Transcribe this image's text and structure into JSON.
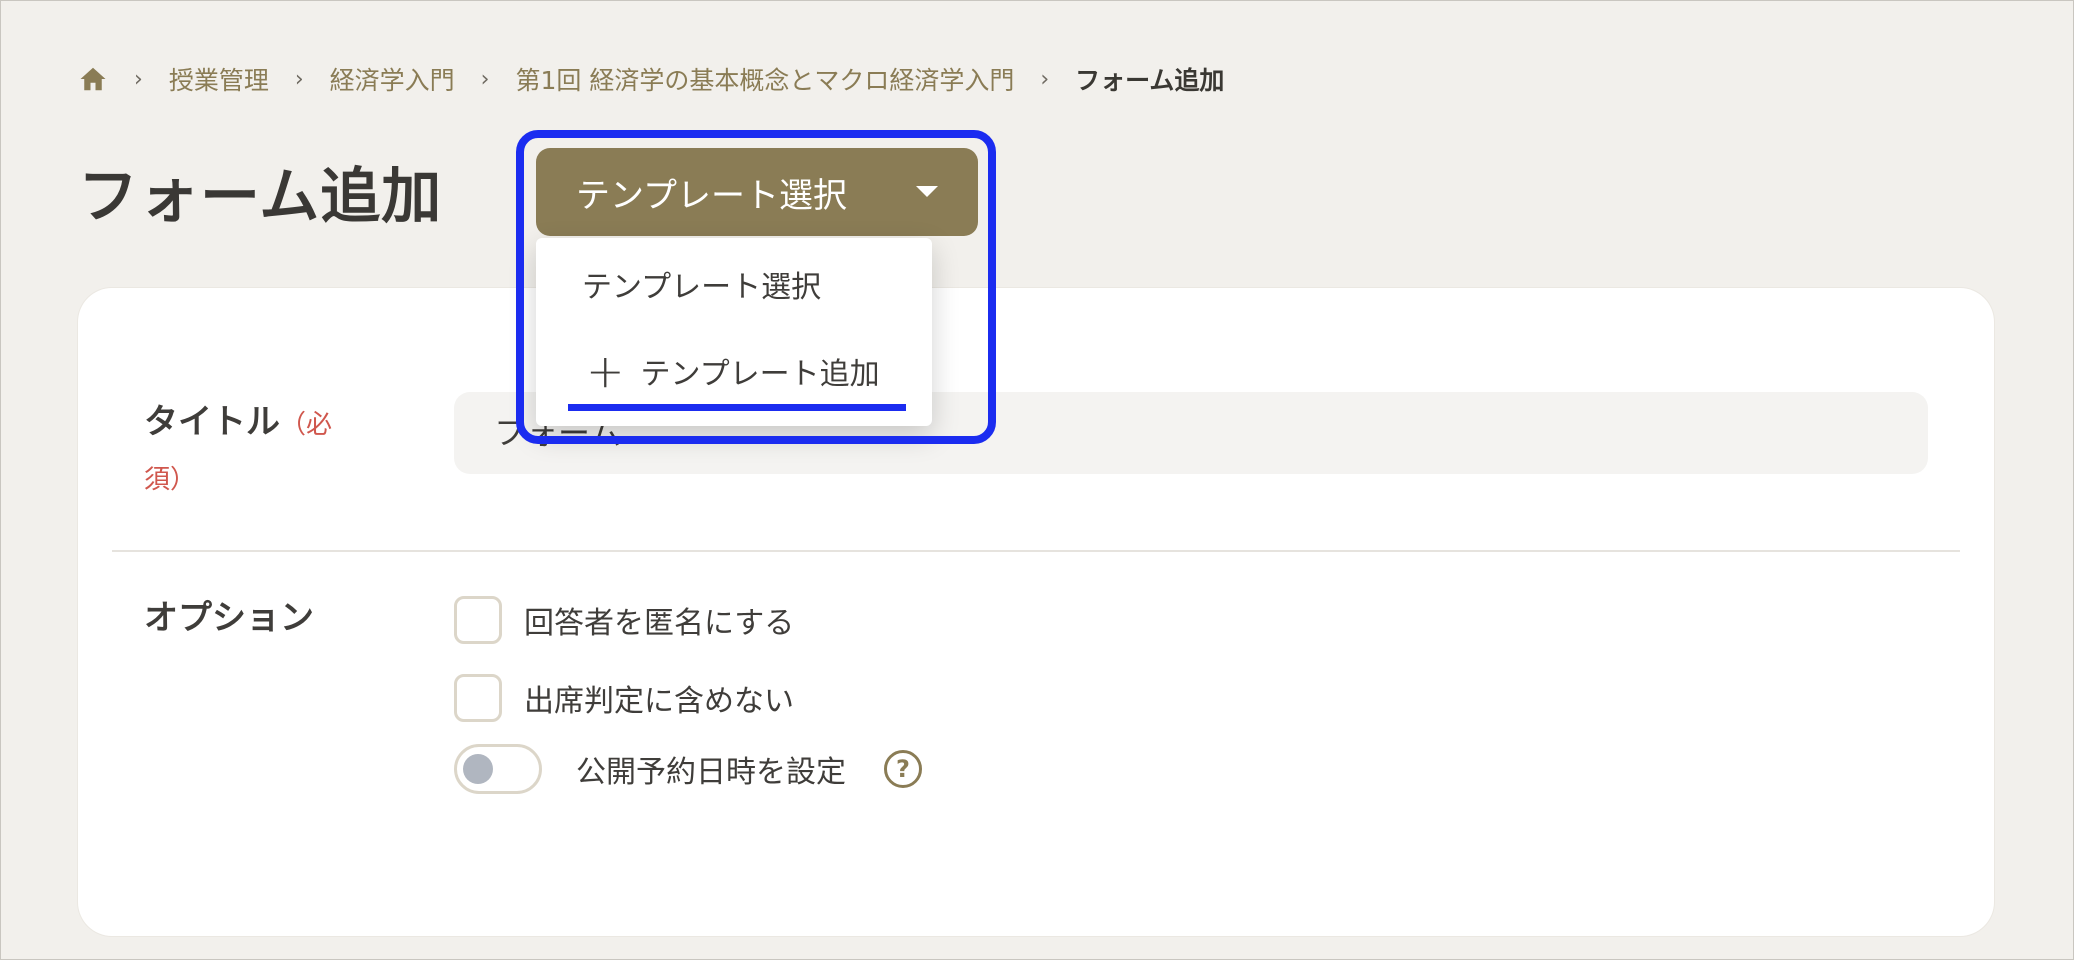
{
  "breadcrumb": {
    "items": [
      "授業管理",
      "経済学入門",
      "第1回 経済学の基本概念とマクロ経済学入門"
    ],
    "current": "フォーム追加"
  },
  "page": {
    "title": "フォーム追加"
  },
  "template_select": {
    "button_label": "テンプレート選択",
    "menu_items": [
      "テンプレート選択",
      "テンプレート追加"
    ]
  },
  "form": {
    "title_label": "タイトル",
    "required_text": "（必須）",
    "title_value": "フォーム",
    "options_label": "オプション",
    "options": [
      {
        "label": "回答者を匿名にする",
        "checked": false
      },
      {
        "label": "出席判定に含めない",
        "checked": false
      }
    ],
    "schedule_toggle": {
      "label": "公開予約日時を設定",
      "on": false
    }
  },
  "colors": {
    "accent": "#8a7c55",
    "highlight": "#1b2cf0",
    "required": "#d0574d",
    "background": "#f2f0ec"
  }
}
